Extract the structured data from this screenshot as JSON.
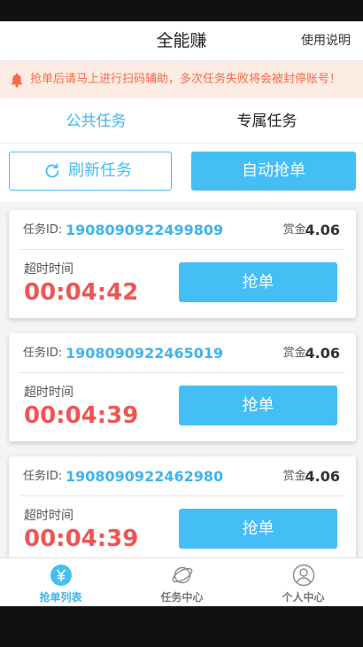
{
  "header": {
    "title": "全能赚",
    "help_label": "使用说明"
  },
  "notice": {
    "icon": "bell-icon",
    "text": "抢单后请马上进行扫码辅助，多次任务失败将会被封停账号！"
  },
  "tabs": [
    {
      "label": "公共任务",
      "active": true
    },
    {
      "label": "专属任务",
      "active": false
    }
  ],
  "actions": {
    "refresh_label": "刷新任务",
    "auto_label": "自动抢单"
  },
  "card_labels": {
    "id_label": "任务ID:",
    "reward_label": "赏金:",
    "timeout_label": "超时时间",
    "grab_label": "抢单"
  },
  "tasks": [
    {
      "id": "1908090922499809",
      "reward": "4.06",
      "timeout": "00:04:42"
    },
    {
      "id": "1908090922465019",
      "reward": "4.06",
      "timeout": "00:04:39"
    },
    {
      "id": "1908090922462980",
      "reward": "4.06",
      "timeout": "00:04:39"
    }
  ],
  "tabbar": [
    {
      "label": "抢单列表",
      "icon": "yen-coin-icon",
      "active": true
    },
    {
      "label": "任务中心",
      "icon": "orbit-icon",
      "active": false
    },
    {
      "label": "个人中心",
      "icon": "user-icon",
      "active": false
    }
  ],
  "colors": {
    "accent": "#45bef5",
    "timer": "#f25454",
    "notice_text": "#f56c4c",
    "notice_bg": "#fdece4"
  }
}
